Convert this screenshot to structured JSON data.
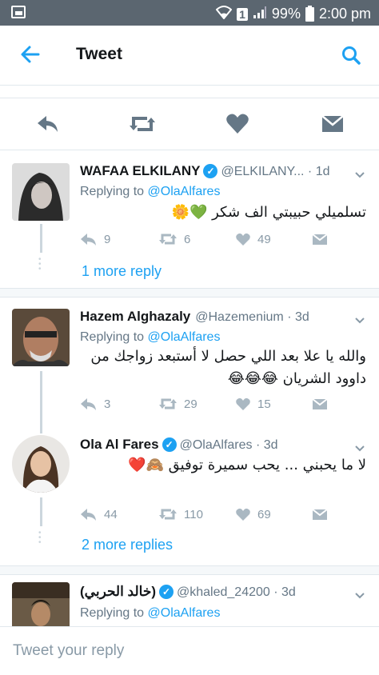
{
  "status": {
    "battery": "99%",
    "time": "2:00 pm",
    "sim_label": "1",
    "icons": [
      "image-notification-icon",
      "wifi-icon",
      "sim-icon",
      "signal-icon",
      "battery-icon"
    ]
  },
  "header": {
    "title": "Tweet",
    "back_icon": "arrow-left-icon",
    "search_icon": "search-icon"
  },
  "actions": [
    "reply-icon",
    "retweet-icon",
    "heart-icon",
    "direct-message-icon"
  ],
  "tweets": [
    {
      "name": "WAFAA ELKILANY",
      "handle": "@ELKILANY...",
      "time": "1d",
      "replying_prefix": "Replying to ",
      "replying_to": "@OlaAlfares",
      "body": "تسلميلي حبيبتي الف شكر 💚🌼",
      "replies": "9",
      "retweets": "6",
      "likes": "49",
      "more": "1 more reply"
    },
    {
      "name": "Hazem Alghazaly",
      "handle": "@Hazemenium",
      "time": "3d",
      "replying_prefix": "Replying to ",
      "replying_to": "@OlaAlfares",
      "body": "والله  يا علا بعد اللي حصل لا أستبعد زواجك من داوود الشريان 😂😂😂",
      "replies": "3",
      "retweets": "29",
      "likes": "15"
    },
    {
      "name": "Ola Al Fares",
      "handle": "@OlaAlfares",
      "time": "3d",
      "body": "لا ما يحبني ... يحب سميرة توفيق 🙈❤️",
      "replies": "44",
      "retweets": "110",
      "likes": "69",
      "more": "2 more replies"
    },
    {
      "name": "(خالد الحربي)",
      "handle": "@khaled_24200",
      "time": "3d",
      "replying_prefix": "Replying to ",
      "replying_to": "@OlaAlfares"
    }
  ],
  "compose": {
    "placeholder": "Tweet your reply"
  },
  "colors": {
    "accent": "#1da1f2",
    "statusbar": "#5b6670",
    "muted": "#657786"
  }
}
